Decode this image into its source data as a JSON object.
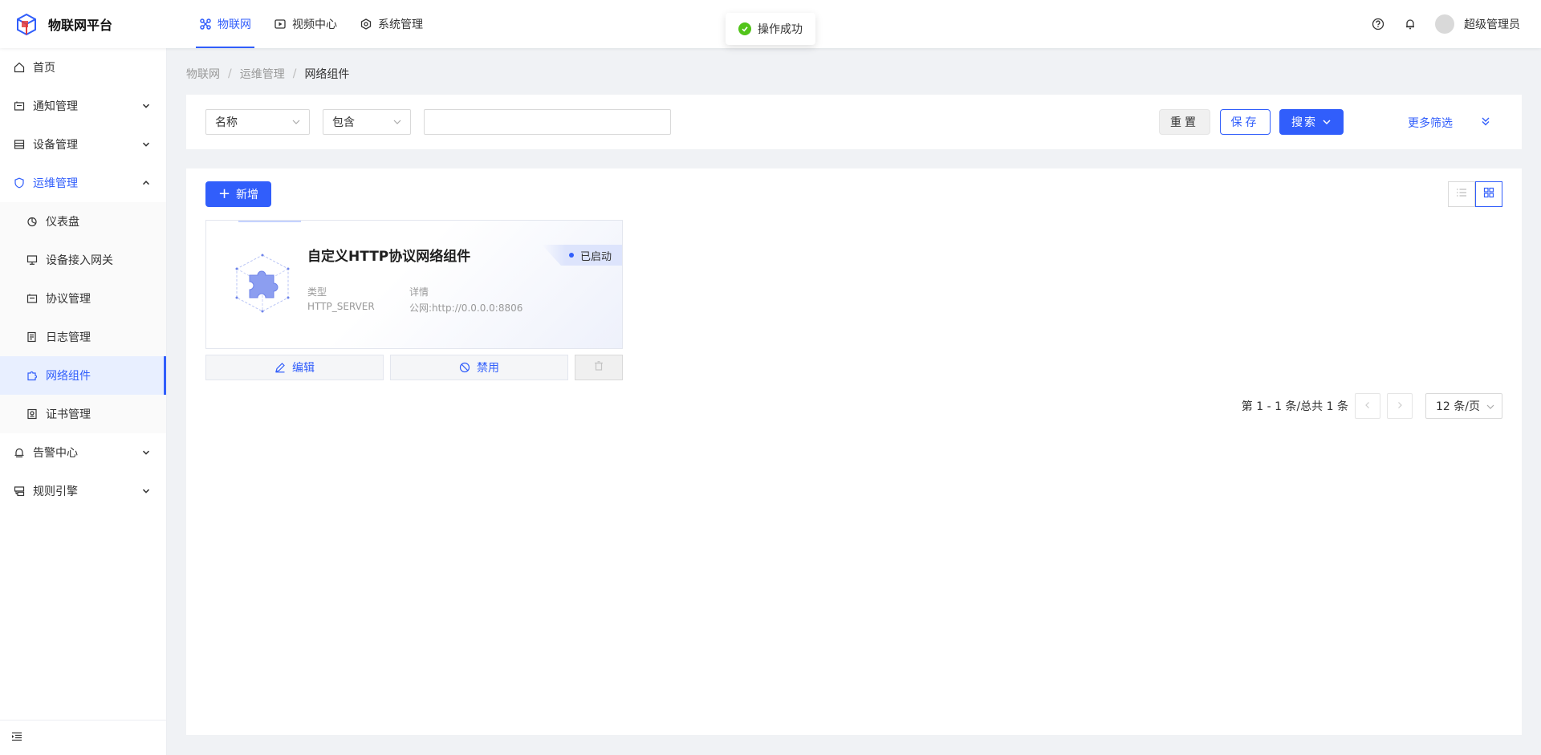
{
  "app": {
    "title": "物联网平台"
  },
  "topnav": [
    {
      "label": "物联网",
      "icon": "iot-icon",
      "active": true
    },
    {
      "label": "视频中心",
      "icon": "video-icon",
      "active": false
    },
    {
      "label": "系统管理",
      "icon": "system-icon",
      "active": false
    }
  ],
  "header": {
    "username": "超级管理员"
  },
  "toast": {
    "message": "操作成功"
  },
  "sidebar": {
    "items": [
      {
        "label": "首页"
      },
      {
        "label": "通知管理"
      },
      {
        "label": "设备管理"
      },
      {
        "label": "运维管理"
      },
      {
        "label": "告警中心"
      },
      {
        "label": "规则引擎"
      }
    ],
    "submenu": [
      {
        "label": "仪表盘"
      },
      {
        "label": "设备接入网关"
      },
      {
        "label": "协议管理"
      },
      {
        "label": "日志管理"
      },
      {
        "label": "网络组件"
      },
      {
        "label": "证书管理"
      }
    ]
  },
  "breadcrumb": [
    "物联网",
    "运维管理",
    "网络组件"
  ],
  "filter": {
    "field": "名称",
    "operator": "包含",
    "value": "",
    "reset_label": "重置",
    "save_label": "保存",
    "search_label": "搜索",
    "more_label": "更多筛选"
  },
  "toolbar": {
    "add_label": "新增"
  },
  "card": {
    "title": "自定义HTTP协议网络组件",
    "status": "已启动",
    "type_label": "类型",
    "type_value": "HTTP_SERVER",
    "detail_label": "详情",
    "detail_value": "公网:http://0.0.0.0:8806",
    "edit_label": "编辑",
    "disable_label": "禁用"
  },
  "pagination": {
    "total_text": "第 1 - 1 条/总共 1 条",
    "page_size": "12 条/页"
  },
  "colors": {
    "primary": "#315efb",
    "success": "#52c41a"
  }
}
